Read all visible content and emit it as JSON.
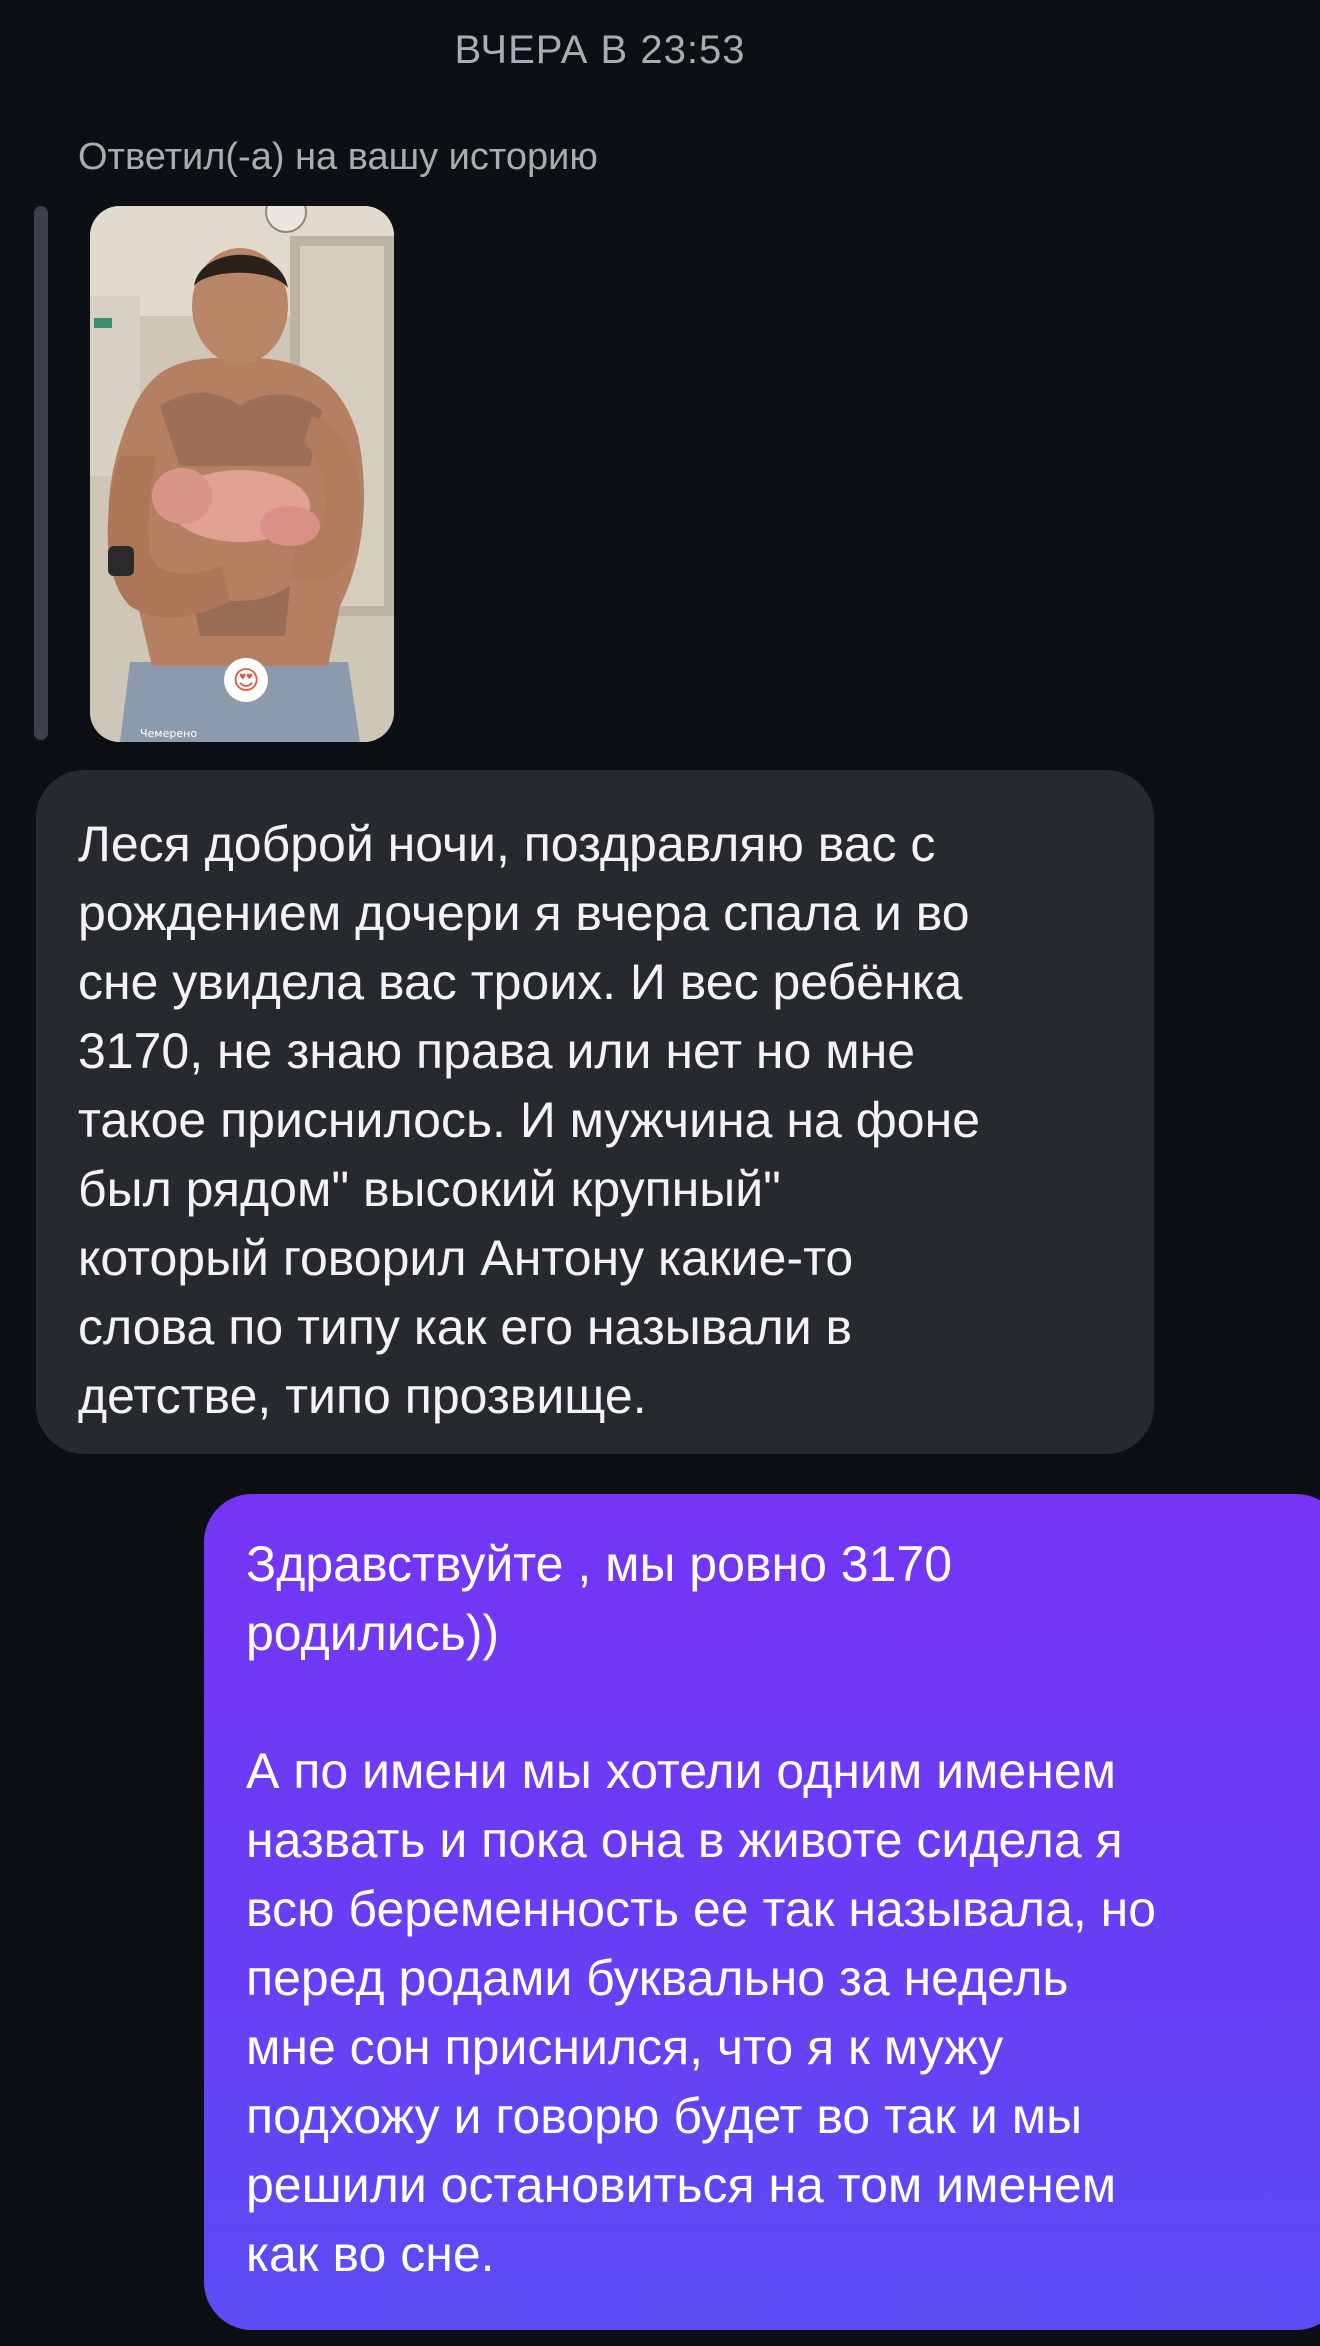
{
  "chat": {
    "timestamp": "ВЧЕРА В 23:53",
    "reply_context": "Ответил(-а) на вашу историю",
    "story": {
      "caption": "Чемерено",
      "reaction": "😍"
    },
    "messages": [
      {
        "direction": "incoming",
        "text": "Леся доброй ночи, поздравляю вас с\nрождением дочери  я вчера спала и во\nсне увидела вас троих. И вес ребёнка\n3170, не знаю права или нет но мне\nтакое приснилось. И мужчина на фоне\nбыл рядом\"  высокий крупный\"\nкоторый говорил Антону какие-то\nслова по типу как его называли в\nдетстве, типо прозвище."
      },
      {
        "direction": "outgoing",
        "text": "Здравствуйте , мы ровно 3170\nродились))\n\nА по имени мы хотели одним именем\nназвать и пока она в животе сидела я\nвсю беременность ее так называла, но\nперед родами буквально за недель\nмне сон приснился, что я к мужу\nподхожу и говорю будет во так и мы\nрешили остановиться на том именем\nкак во сне."
      }
    ]
  },
  "colors": {
    "background": "#0c1014",
    "incoming_bubble": "#262a2f",
    "outgoing_gradient_top": "#7635f6",
    "outgoing_gradient_bottom": "#5c4cf4",
    "meta_text": "#a8adb3"
  }
}
